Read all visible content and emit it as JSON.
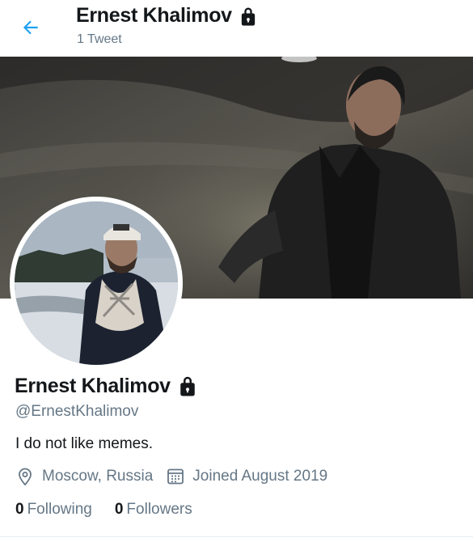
{
  "header": {
    "title": "Ernest Khalimov",
    "tweet_count": "1 Tweet"
  },
  "profile": {
    "name": "Ernest Khalimov",
    "handle": "@ErnestKhalimov",
    "bio": "I do not like memes.",
    "location": "Moscow, Russia",
    "joined": "Joined August 2019",
    "following_count": "0",
    "following_label": "Following",
    "followers_count": "0",
    "followers_label": "Followers"
  },
  "icons": {
    "back": "arrow-left-icon",
    "lock": "lock-icon",
    "location": "location-pin-icon",
    "calendar": "calendar-icon"
  },
  "colors": {
    "accent": "#1da1f2",
    "text": "#14171a",
    "secondary": "#657786"
  }
}
